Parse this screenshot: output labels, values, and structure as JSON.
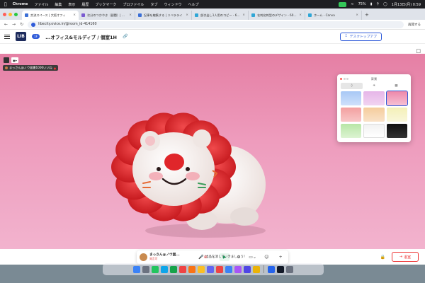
{
  "menubar": {
    "app": "Chrome",
    "items": [
      "ファイル",
      "編集",
      "表示",
      "履歴",
      "ブックマーク",
      "プロファイル",
      "タブ",
      "ウィンドウ",
      "ヘルプ"
    ],
    "battery": "75%",
    "clock": "1月13日(月) 0:59"
  },
  "tabs": [
    {
      "label": "交流スペース | 大阪オフィ",
      "color": "#3b6fd6",
      "active": true
    },
    {
      "label": "次分のつかやき（副題）| リベラ",
      "color": "#7a5bd1",
      "active": false
    },
    {
      "label": "記事を編集する | リベラライ",
      "color": "#3b6fd6",
      "active": false
    },
    {
      "label": "部次出し1人用のコピー - 600 ×",
      "color": "#2fa6d6",
      "active": false
    },
    {
      "label": "名刺名刺型のデザイン - 600 ×",
      "color": "#2fa6d6",
      "active": false
    },
    {
      "label": "ホーム - Canva",
      "color": "#2fa6d6",
      "active": false
    }
  ],
  "address": {
    "url": "libecity.ovice.in/@room_id-414160",
    "profile": "再開する"
  },
  "header": {
    "logo": "LIB",
    "floor": "1F",
    "title": "...オフィス&モルディブ / 個室1H",
    "download_label": "デスクトップアプ"
  },
  "room": {
    "status_text": "まっさん@ノウ図書1000いいね",
    "plush_colors": {
      "mane": "#e0262a",
      "face": "#f4ecea",
      "cheek": "#f2a1ad"
    }
  },
  "bg_panel": {
    "title": "背景",
    "tabs": [
      {
        "icon": "image-icon",
        "selected": true
      },
      {
        "icon": "blur-icon",
        "selected": false
      },
      {
        "icon": "picture-icon",
        "selected": false
      }
    ],
    "swatches": [
      {
        "from": "#a8c8f5",
        "to": "#cfe0fb",
        "selected": false
      },
      {
        "from": "#e6b6e8",
        "to": "#f1d3f1",
        "selected": false
      },
      {
        "from": "#ee88aa",
        "to": "#f6c1d4",
        "selected": true
      },
      {
        "from": "#f3a0a0",
        "to": "#f8c6c6",
        "selected": false
      },
      {
        "from": "#f5cc9c",
        "to": "#f9e2c8",
        "selected": false
      },
      {
        "from": "#f4f0b8",
        "to": "#f9f7da",
        "selected": false
      },
      {
        "from": "#b8e6a6",
        "to": "#dcf3d2",
        "selected": false
      },
      {
        "from": "#f2f2f2",
        "to": "#ffffff",
        "selected": false
      },
      {
        "from": "#111111",
        "to": "#333333",
        "selected": false
      }
    ]
  },
  "controls": {
    "user_name": "まっさん@ノウ図...",
    "user_status": "発言可",
    "exit_label": "退室"
  },
  "underlay_text": "出品を消していきましょう！",
  "dock": {
    "colors": [
      "#3b82f6",
      "#6b7280",
      "#22c55e",
      "#0ea5e9",
      "#16a34a",
      "#ef4444",
      "#f97316",
      "#fbbf24",
      "#6366f1",
      "#ef4444",
      "#3b82f6",
      "#a855f7",
      "#4f46e5",
      "#eab308",
      "#2563eb",
      "#111827",
      "#6b7280"
    ]
  }
}
